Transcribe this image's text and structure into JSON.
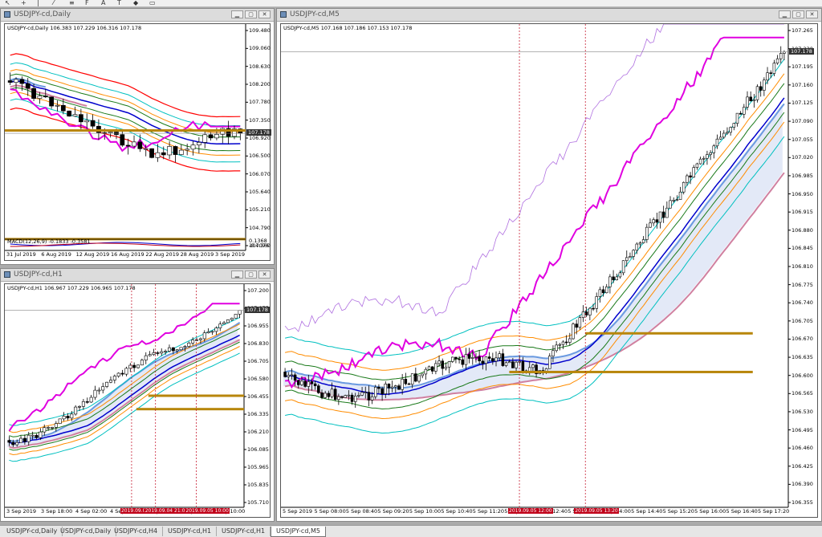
{
  "toolbar": {
    "icons": [
      {
        "name": "arrow-cursor-icon",
        "glyph": "↖"
      },
      {
        "name": "crosshair-icon",
        "glyph": "+"
      },
      {
        "name": "vertical-line-icon",
        "glyph": "|"
      },
      {
        "name": "trendline-icon",
        "glyph": "⁄"
      },
      {
        "name": "channel-icon",
        "glyph": "≡"
      },
      {
        "name": "fibonacci-icon",
        "glyph": "F"
      },
      {
        "name": "text-tool-icon",
        "glyph": "A"
      },
      {
        "name": "label-tool-icon",
        "glyph": "T"
      },
      {
        "name": "shapes-icon",
        "glyph": "◆"
      },
      {
        "name": "timeframe-box-icon",
        "glyph": "▭"
      }
    ]
  },
  "windows": {
    "daily": {
      "title": "USDJPY-cd,Daily",
      "ohlc": "USDJPY-cd,Daily  106.383 107.229 106.316 107.178",
      "price_label": "107.178",
      "y_labels": [
        "109.480",
        "109.060",
        "108.630",
        "108.200",
        "107.780",
        "107.350",
        "106.920",
        "106.500",
        "106.070",
        "105.640",
        "105.210",
        "104.790",
        "104.360"
      ],
      "x_labels": [
        "31 Jul 2019",
        "6 Aug 2019",
        "12 Aug 2019",
        "16 Aug 2019",
        "22 Aug 2019",
        "28 Aug 2019",
        "3 Sep 2019"
      ],
      "macd_text": "MACD(12,26,9) -0.1833 -0.3581",
      "macd_labels": [
        "0.1368",
        "-0.7076"
      ]
    },
    "h1": {
      "title": "USDJPY-cd,H1",
      "ohlc": "USDJPY-cd,H1  106.967 107.229 106.965 107.178",
      "price_label": "107.178",
      "y_labels": [
        "107.200",
        "107.075",
        "106.955",
        "106.830",
        "106.705",
        "106.580",
        "106.455",
        "106.335",
        "106.210",
        "106.085",
        "105.965",
        "105.835",
        "105.710"
      ],
      "x_labels": [
        "3 Sep 2019",
        "3 Sep 18:00",
        "4 Sep 02:00",
        "4 Sep 10:00",
        "4 Sep 18:00",
        "5 Sep 02:00",
        "5 Sep 10:00"
      ],
      "markers": [
        "2019.09.0·",
        "2019.09.04 21:00",
        "2019.09.05 10:00"
      ]
    },
    "m5": {
      "title": "USDJPY-cd,M5",
      "ohlc": "USDJPY-cd,M5  107.168 107.186 107.153 107.178",
      "price_label": "107.178",
      "y_labels": [
        "107.265",
        "107.230",
        "107.195",
        "107.160",
        "107.125",
        "107.090",
        "107.055",
        "107.020",
        "106.985",
        "106.950",
        "106.915",
        "106.880",
        "106.845",
        "106.810",
        "106.775",
        "106.740",
        "106.705",
        "106.670",
        "106.635",
        "106.600",
        "106.565",
        "106.530",
        "106.495",
        "106.460",
        "106.425",
        "106.390",
        "106.355"
      ],
      "x_labels": [
        "5 Sep 2019",
        "5 Sep 08:00",
        "5 Sep 08:40",
        "5 Sep 09:20",
        "5 Sep 10:00",
        "5 Sep 10:40",
        "5 Sep 11:20",
        "5 Sep 12:00",
        "5 Sep 12:40",
        "5 Sep 13:20",
        "5 Sep 14:00",
        "5 Sep 14:40",
        "5 Sep 15:20",
        "5 Sep 16:00",
        "5 Sep 16:40",
        "5 Sep 17:20"
      ],
      "markers": [
        "2019.09.05 12:00",
        "2019.09.05 13:20"
      ]
    }
  },
  "tabs": [
    "USDJPY-cd,Daily",
    "USDJPY-cd,Daily",
    "USDJPY-cd,H4",
    "USDJPY-cd,H1",
    "USDJPY-cd,H1",
    "USDJPY-cd,M5"
  ],
  "active_tab": 5,
  "colors": {
    "background": "#ababab",
    "title_bar": "#dcdcdc",
    "horizontal_level": "#b8860b",
    "marker": "#c00018",
    "upper_band": "#ff0000",
    "sma": "#0000cc",
    "cloud_line": "#e000e0",
    "ichimoku_span": "#1a7a1a"
  }
}
